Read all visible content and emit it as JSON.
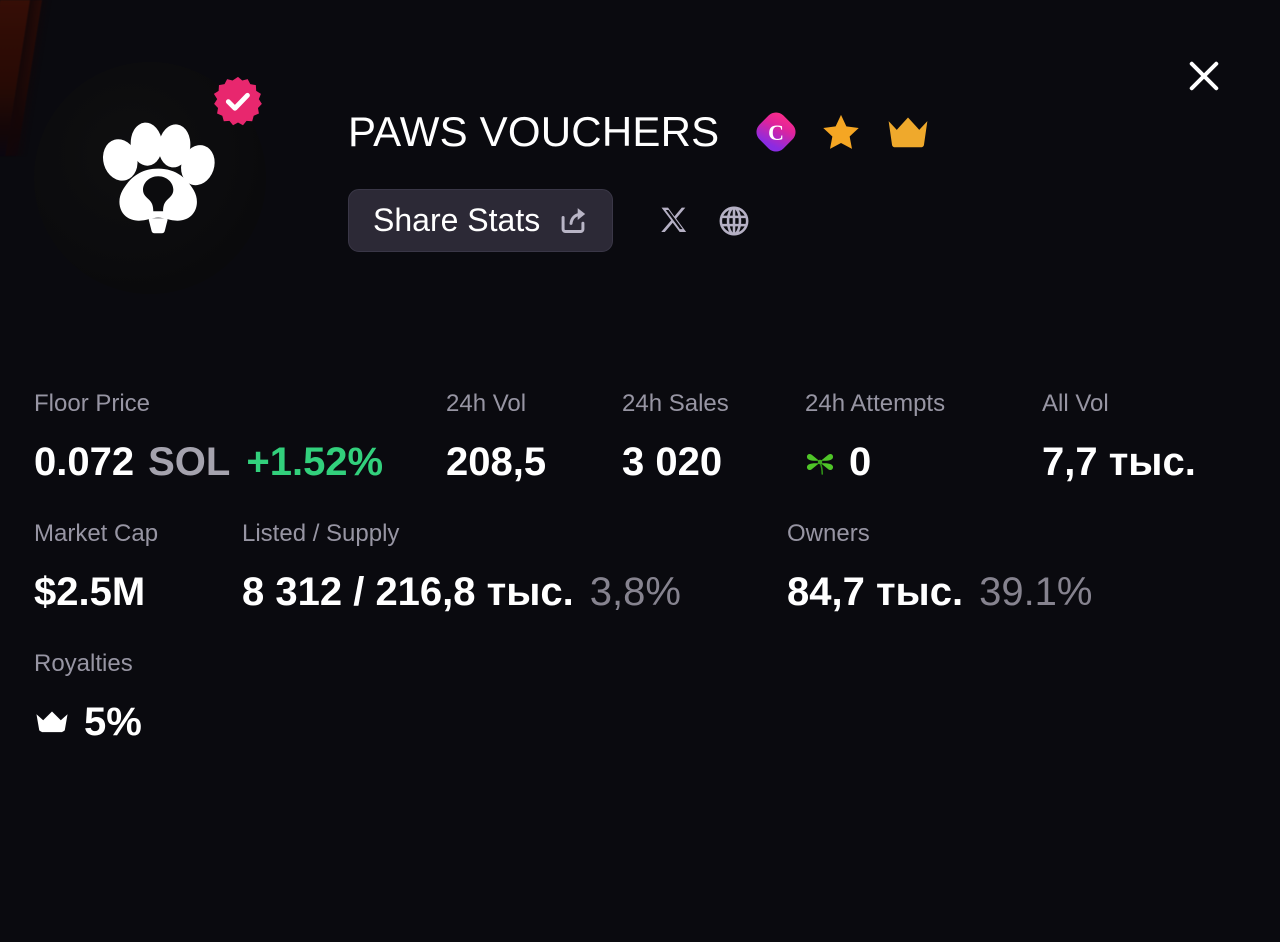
{
  "window": {
    "background_color": "#0a0a0f",
    "close_label": "×"
  },
  "collection": {
    "name": "PAWS VOUCHERS",
    "verified": true,
    "avatar_icon": "paw-print-logo",
    "badges": [
      {
        "name": "magic-eden-badge",
        "icon": "me-diamond-c",
        "color": "#e42575"
      },
      {
        "name": "star-badge",
        "icon": "star",
        "color": "#f5a623"
      },
      {
        "name": "crown-badge",
        "icon": "crown",
        "color": "#f0a92c"
      }
    ]
  },
  "actions": {
    "share_stats_label": "Share Stats",
    "share_icon": "share-export-icon",
    "social": [
      {
        "name": "twitter-x-link",
        "icon": "x-icon"
      },
      {
        "name": "website-link",
        "icon": "globe-icon"
      }
    ]
  },
  "stats": {
    "row1": [
      {
        "key": "floor-price",
        "label": "Floor Price",
        "value": "0.072",
        "unit": "SOL",
        "change": "+1.52%",
        "change_color": "#32d07c"
      },
      {
        "key": "24h-vol",
        "label": "24h Vol",
        "value": "208,5"
      },
      {
        "key": "24h-sales",
        "label": "24h Sales",
        "value": "3 020"
      },
      {
        "key": "24h-attempts",
        "label": "24h Attempts",
        "value": "0",
        "icon": "four-leaf-clover-icon"
      },
      {
        "key": "all-vol",
        "label": "All Vol",
        "value": "7,7 тыс."
      }
    ],
    "row2": [
      {
        "key": "market-cap",
        "label": "Market Cap",
        "value": "$2.5M"
      },
      {
        "key": "listed-supply",
        "label": "Listed / Supply",
        "value": "8 312 / 216,8 тыс.",
        "sub": "3,8%"
      },
      {
        "key": "owners",
        "label": "Owners",
        "value": "84,7 тыс.",
        "sub": "39.1%"
      }
    ],
    "row3": [
      {
        "key": "royalties",
        "label": "Royalties",
        "value": "5%",
        "icon": "crown-icon"
      }
    ]
  }
}
